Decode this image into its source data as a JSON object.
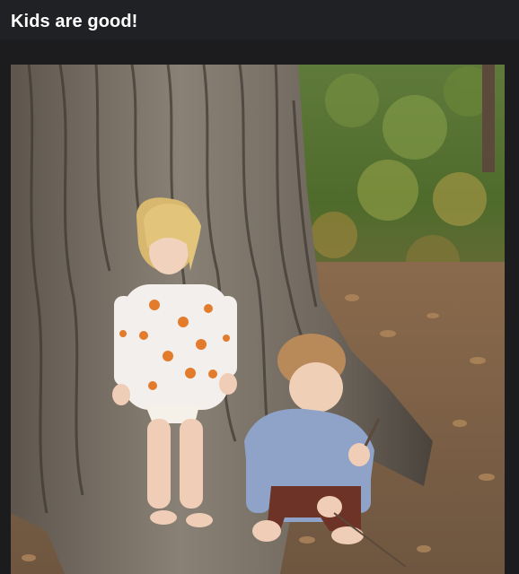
{
  "post": {
    "title": "Kids are good!"
  },
  "colors": {
    "background": "#1c1c1e",
    "title_text": "#ffffff"
  },
  "photo": {
    "subject_icon": "photo-two-children-by-tree"
  }
}
